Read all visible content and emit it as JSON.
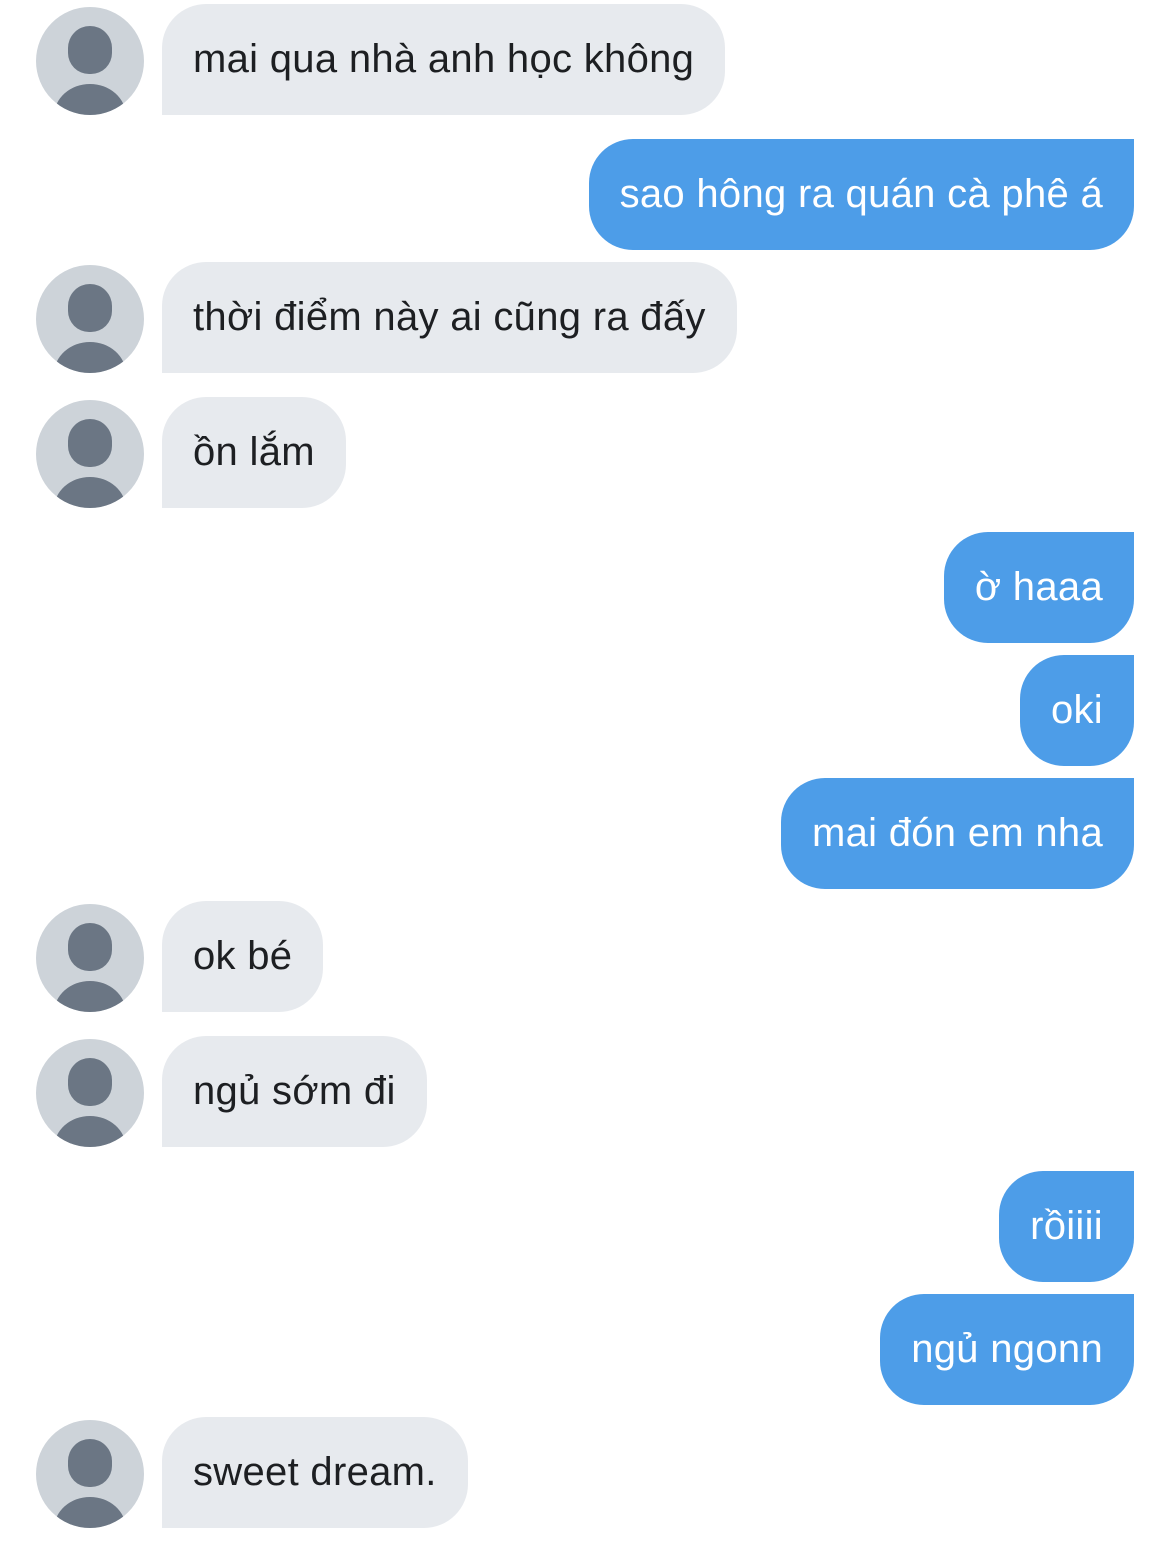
{
  "conversation": {
    "messages": [
      {
        "sender": "them",
        "text": "mai qua nhà anh học không"
      },
      {
        "sender": "me",
        "text": "sao hông ra quán cà phê á"
      },
      {
        "sender": "them",
        "text": "thời điểm này ai cũng ra đấy"
      },
      {
        "sender": "them",
        "text": "ồn lắm"
      },
      {
        "sender": "me",
        "text": "ờ haaa"
      },
      {
        "sender": "me",
        "text": "oki"
      },
      {
        "sender": "me",
        "text": "mai đón em nha"
      },
      {
        "sender": "them",
        "text": "ok bé"
      },
      {
        "sender": "them",
        "text": "ngủ sớm đi"
      },
      {
        "sender": "me",
        "text": "rồiiii"
      },
      {
        "sender": "me",
        "text": "ngủ ngonn"
      },
      {
        "sender": "them",
        "text": "sweet dream."
      }
    ]
  },
  "colors": {
    "incoming_bubble": "#e7eaee",
    "outgoing_bubble": "#4d9de8",
    "avatar_bg": "#cdd3d9",
    "avatar_figure": "#6b7684"
  },
  "icons": {
    "avatar": "default-person-icon"
  }
}
